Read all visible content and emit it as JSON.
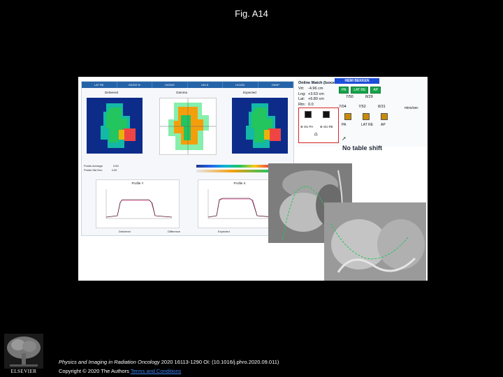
{
  "title": "Fig. A14",
  "software": {
    "tabs": [
      "LAT RE",
      "GS/DS %",
      "HIGN/S",
      "HI/LS",
      "HCI/2D",
      "GENP"
    ],
    "view_labels": [
      "Delivered",
      "Gamma",
      "Expected"
    ],
    "stats": [
      "Points Average",
      "Points Std Dev"
    ],
    "stat_values": [
      "0.60",
      "4.00"
    ],
    "profile_titles": [
      "Profile Y",
      "Profile X"
    ],
    "legend": [
      "Delivered",
      "Difference",
      "Expected"
    ]
  },
  "online_match": {
    "hemi_label": "HEMI BEKKEN",
    "title": "Online Match (Isoce",
    "rows": [
      {
        "label": "Vrt:",
        "value": "-4.96 cm"
      },
      {
        "label": "Lng:",
        "value": "+3.63 cm"
      },
      {
        "label": "Lat:",
        "value": "+6.80 cm"
      },
      {
        "label": "Rtn:",
        "value": "0.0"
      }
    ],
    "fields": [
      "PA",
      "LAT RE",
      "AP"
    ],
    "field_numbers": [
      "7/04",
      "7/52",
      "8/31"
    ],
    "field_values": [
      "7/50",
      "8/29"
    ],
    "unit": "mins/sec",
    "image_labels": [
      "PA",
      "LAT RE",
      "AP"
    ],
    "boxed_labels": [
      "⊕ SU PA",
      "⊕ SU RE"
    ],
    "no_table_shift": "No table shift"
  },
  "citation": {
    "journal": "Physics and Imaging in Radiation Oncology",
    "ref": " 2020 16113-1290 OI: (10.1016/j.phro.2020.09.011)",
    "copyright": "Copyright © 2020 The Authors ",
    "terms": "Terms and Conditions"
  },
  "publisher": "ELSEVIER"
}
